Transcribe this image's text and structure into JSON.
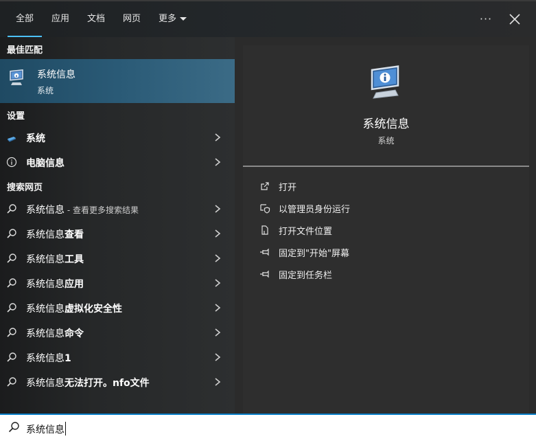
{
  "tabs": [
    {
      "label": "全部"
    },
    {
      "label": "应用"
    },
    {
      "label": "文档"
    },
    {
      "label": "网页"
    },
    {
      "label": "更多"
    }
  ],
  "topbar": {
    "more_icon": "ellipsis-icon",
    "close_icon": "close-icon",
    "accent": "#4cc2ff"
  },
  "best_match": {
    "section": "最佳匹配",
    "title": "系统信息",
    "subtitle": "系统",
    "icon": "system-information-icon"
  },
  "settings": {
    "section": "设置",
    "items": [
      {
        "label": "系统",
        "icon": "system-icon"
      },
      {
        "label": "电脑信息",
        "icon": "info-icon"
      }
    ]
  },
  "web": {
    "section": "搜索网页",
    "items": [
      {
        "label": "系统信息",
        "suffix": " - 查看更多搜索结果",
        "bold": ""
      },
      {
        "label": "系统信息",
        "bold": "查看"
      },
      {
        "label": "系统信息",
        "bold": "工具"
      },
      {
        "label": "系统信息",
        "bold": "应用"
      },
      {
        "label": "系统信息",
        "bold": "虚拟化安全性"
      },
      {
        "label": "系统信息",
        "bold": "命令"
      },
      {
        "label": "系统信息",
        "bold": "1"
      },
      {
        "label": "系统信息",
        "bold": "无法打开。nfo文件"
      }
    ]
  },
  "detail": {
    "title": "系统信息",
    "subtitle": "系统",
    "actions": [
      {
        "label": "打开",
        "icon": "open-icon"
      },
      {
        "label": "以管理员身份运行",
        "icon": "shield-icon"
      },
      {
        "label": "打开文件位置",
        "icon": "file-location-icon"
      },
      {
        "label": "固定到\"开始\"屏幕",
        "icon": "pin-icon"
      },
      {
        "label": "固定到任务栏",
        "icon": "pin-icon"
      }
    ]
  },
  "search": {
    "value": "系统信息"
  }
}
